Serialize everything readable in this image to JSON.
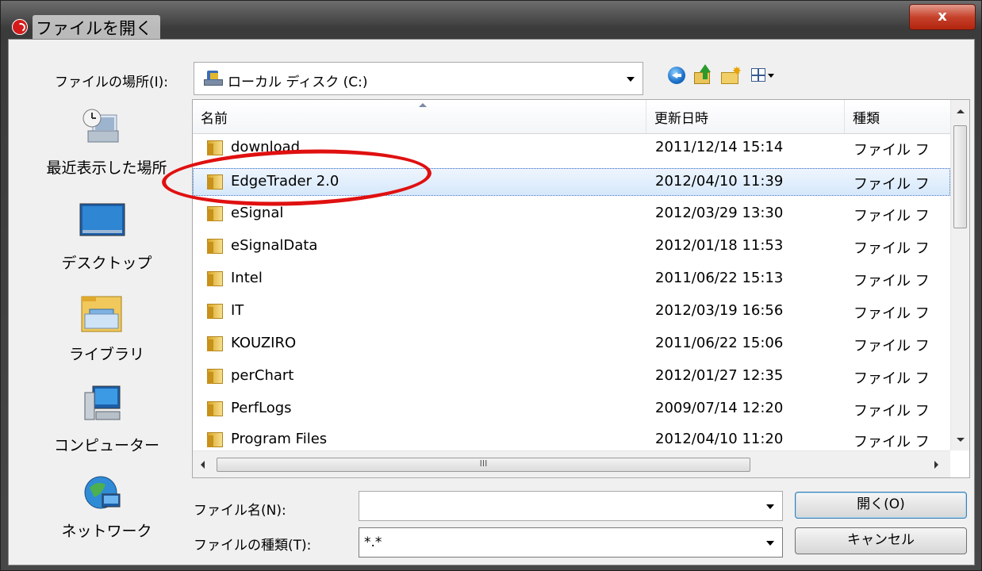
{
  "window": {
    "title": "ファイルを開く",
    "close_glyph": "x"
  },
  "toolbar": {
    "look_in_label": "ファイルの場所(I):",
    "look_in_value": "ローカル ディスク (C:)"
  },
  "places": [
    {
      "label": "最近表示した場所",
      "icon": "recent-places-icon"
    },
    {
      "label": "デスクトップ",
      "icon": "desktop-icon"
    },
    {
      "label": "ライブラリ",
      "icon": "libraries-icon"
    },
    {
      "label": "コンピューター",
      "icon": "computer-icon"
    },
    {
      "label": "ネットワーク",
      "icon": "network-icon"
    }
  ],
  "file_list": {
    "columns": [
      "名前",
      "更新日時",
      "種類"
    ],
    "rows": [
      {
        "name": "download",
        "date": "2011/12/14 15:14",
        "type": "ファイル フ"
      },
      {
        "name": "EdgeTrader 2.0",
        "date": "2012/04/10 11:39",
        "type": "ファイル フ",
        "selected": true
      },
      {
        "name": "eSignal",
        "date": "2012/03/29 13:30",
        "type": "ファイル フ"
      },
      {
        "name": "eSignalData",
        "date": "2012/01/18 11:53",
        "type": "ファイル フ"
      },
      {
        "name": "Intel",
        "date": "2011/06/22 15:13",
        "type": "ファイル フ"
      },
      {
        "name": "IT",
        "date": "2012/03/19 16:56",
        "type": "ファイル フ"
      },
      {
        "name": "KOUZIRO",
        "date": "2011/06/22 15:06",
        "type": "ファイル フ"
      },
      {
        "name": "perChart",
        "date": "2012/01/27 12:35",
        "type": "ファイル フ"
      },
      {
        "name": "PerfLogs",
        "date": "2009/07/14 12:20",
        "type": "ファイル フ"
      },
      {
        "name": "Program Files",
        "date": "2012/04/10 11:20",
        "type": "ファイル フ"
      }
    ]
  },
  "hscroll_grip": "III",
  "filename": {
    "label": "ファイル名(N):",
    "value": ""
  },
  "filetype": {
    "label": "ファイルの種類(T):",
    "value": "*.*"
  },
  "buttons": {
    "open": "開く(O)",
    "cancel": "キャンセル"
  },
  "colors": {
    "highlight_oval": "#e01010",
    "selection": "#d6e8fb"
  }
}
